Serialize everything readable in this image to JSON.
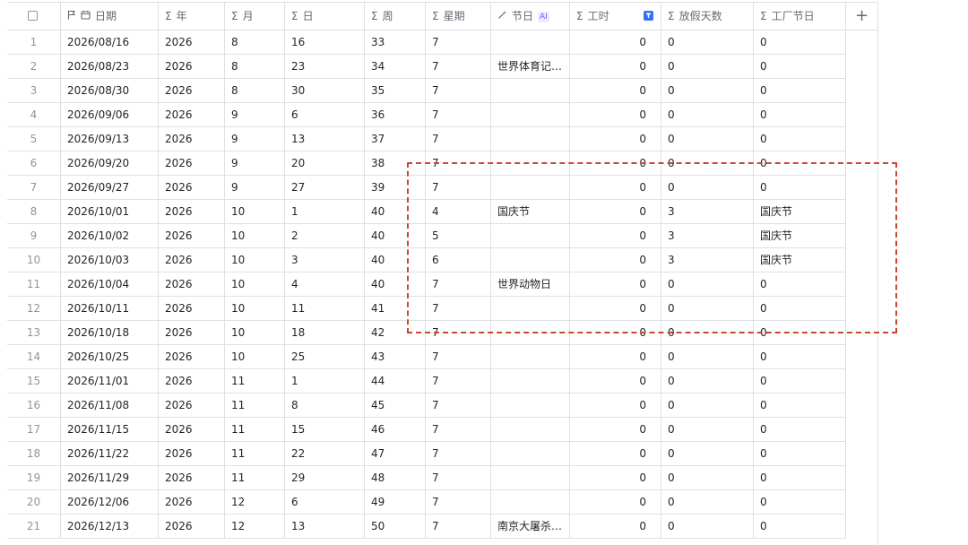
{
  "header": {
    "date_label": "日期",
    "year_label": "年",
    "month_label": "月",
    "day_label": "日",
    "week_label": "周",
    "weekday_label": "星期",
    "festival_label": "节日",
    "festival_ai_badge": "AI",
    "hours_label": "工时",
    "holiday_days_label": "放假天数",
    "factory_festival_label": "工厂节日",
    "sigma_glyph": "Σ",
    "add_column_glyph": "+"
  },
  "colors": {
    "border": "#dee0e3",
    "header_text": "#646a73",
    "index_text": "#8f959e",
    "ai_badge": "#7a5cf5",
    "filter_icon": "#3370ff",
    "highlight_dash": "#c9472c"
  },
  "rows": [
    {
      "idx": "1",
      "date": "2026/08/16",
      "year": "2026",
      "month": "8",
      "day": "16",
      "week": "33",
      "weekday": "7",
      "festival": "",
      "hours": "0",
      "holiday": "0",
      "factory": "0"
    },
    {
      "idx": "2",
      "date": "2026/08/23",
      "year": "2026",
      "month": "8",
      "day": "23",
      "week": "34",
      "weekday": "7",
      "festival": "世界体育记…",
      "hours": "0",
      "holiday": "0",
      "factory": "0"
    },
    {
      "idx": "3",
      "date": "2026/08/30",
      "year": "2026",
      "month": "8",
      "day": "30",
      "week": "35",
      "weekday": "7",
      "festival": "",
      "hours": "0",
      "holiday": "0",
      "factory": "0"
    },
    {
      "idx": "4",
      "date": "2026/09/06",
      "year": "2026",
      "month": "9",
      "day": "6",
      "week": "36",
      "weekday": "7",
      "festival": "",
      "hours": "0",
      "holiday": "0",
      "factory": "0"
    },
    {
      "idx": "5",
      "date": "2026/09/13",
      "year": "2026",
      "month": "9",
      "day": "13",
      "week": "37",
      "weekday": "7",
      "festival": "",
      "hours": "0",
      "holiday": "0",
      "factory": "0"
    },
    {
      "idx": "6",
      "date": "2026/09/20",
      "year": "2026",
      "month": "9",
      "day": "20",
      "week": "38",
      "weekday": "7",
      "festival": "",
      "hours": "0",
      "holiday": "0",
      "factory": "0"
    },
    {
      "idx": "7",
      "date": "2026/09/27",
      "year": "2026",
      "month": "9",
      "day": "27",
      "week": "39",
      "weekday": "7",
      "festival": "",
      "hours": "0",
      "holiday": "0",
      "factory": "0"
    },
    {
      "idx": "8",
      "date": "2026/10/01",
      "year": "2026",
      "month": "10",
      "day": "1",
      "week": "40",
      "weekday": "4",
      "festival": "国庆节",
      "hours": "0",
      "holiday": "3",
      "factory": "国庆节"
    },
    {
      "idx": "9",
      "date": "2026/10/02",
      "year": "2026",
      "month": "10",
      "day": "2",
      "week": "40",
      "weekday": "5",
      "festival": "",
      "hours": "0",
      "holiday": "3",
      "factory": "国庆节"
    },
    {
      "idx": "10",
      "date": "2026/10/03",
      "year": "2026",
      "month": "10",
      "day": "3",
      "week": "40",
      "weekday": "6",
      "festival": "",
      "hours": "0",
      "holiday": "3",
      "factory": "国庆节"
    },
    {
      "idx": "11",
      "date": "2026/10/04",
      "year": "2026",
      "month": "10",
      "day": "4",
      "week": "40",
      "weekday": "7",
      "festival": "世界动物日",
      "hours": "0",
      "holiday": "0",
      "factory": "0"
    },
    {
      "idx": "12",
      "date": "2026/10/11",
      "year": "2026",
      "month": "10",
      "day": "11",
      "week": "41",
      "weekday": "7",
      "festival": "",
      "hours": "0",
      "holiday": "0",
      "factory": "0"
    },
    {
      "idx": "13",
      "date": "2026/10/18",
      "year": "2026",
      "month": "10",
      "day": "18",
      "week": "42",
      "weekday": "7",
      "festival": "",
      "hours": "0",
      "holiday": "0",
      "factory": "0"
    },
    {
      "idx": "14",
      "date": "2026/10/25",
      "year": "2026",
      "month": "10",
      "day": "25",
      "week": "43",
      "weekday": "7",
      "festival": "",
      "hours": "0",
      "holiday": "0",
      "factory": "0"
    },
    {
      "idx": "15",
      "date": "2026/11/01",
      "year": "2026",
      "month": "11",
      "day": "1",
      "week": "44",
      "weekday": "7",
      "festival": "",
      "hours": "0",
      "holiday": "0",
      "factory": "0"
    },
    {
      "idx": "16",
      "date": "2026/11/08",
      "year": "2026",
      "month": "11",
      "day": "8",
      "week": "45",
      "weekday": "7",
      "festival": "",
      "hours": "0",
      "holiday": "0",
      "factory": "0"
    },
    {
      "idx": "17",
      "date": "2026/11/15",
      "year": "2026",
      "month": "11",
      "day": "15",
      "week": "46",
      "weekday": "7",
      "festival": "",
      "hours": "0",
      "holiday": "0",
      "factory": "0"
    },
    {
      "idx": "18",
      "date": "2026/11/22",
      "year": "2026",
      "month": "11",
      "day": "22",
      "week": "47",
      "weekday": "7",
      "festival": "",
      "hours": "0",
      "holiday": "0",
      "factory": "0"
    },
    {
      "idx": "19",
      "date": "2026/11/29",
      "year": "2026",
      "month": "11",
      "day": "29",
      "week": "48",
      "weekday": "7",
      "festival": "",
      "hours": "0",
      "holiday": "0",
      "factory": "0"
    },
    {
      "idx": "20",
      "date": "2026/12/06",
      "year": "2026",
      "month": "12",
      "day": "6",
      "week": "49",
      "weekday": "7",
      "festival": "",
      "hours": "0",
      "holiday": "0",
      "factory": "0"
    },
    {
      "idx": "21",
      "date": "2026/12/13",
      "year": "2026",
      "month": "12",
      "day": "13",
      "week": "50",
      "weekday": "7",
      "festival": "南京大屠杀…",
      "hours": "0",
      "holiday": "0",
      "factory": "0"
    }
  ]
}
